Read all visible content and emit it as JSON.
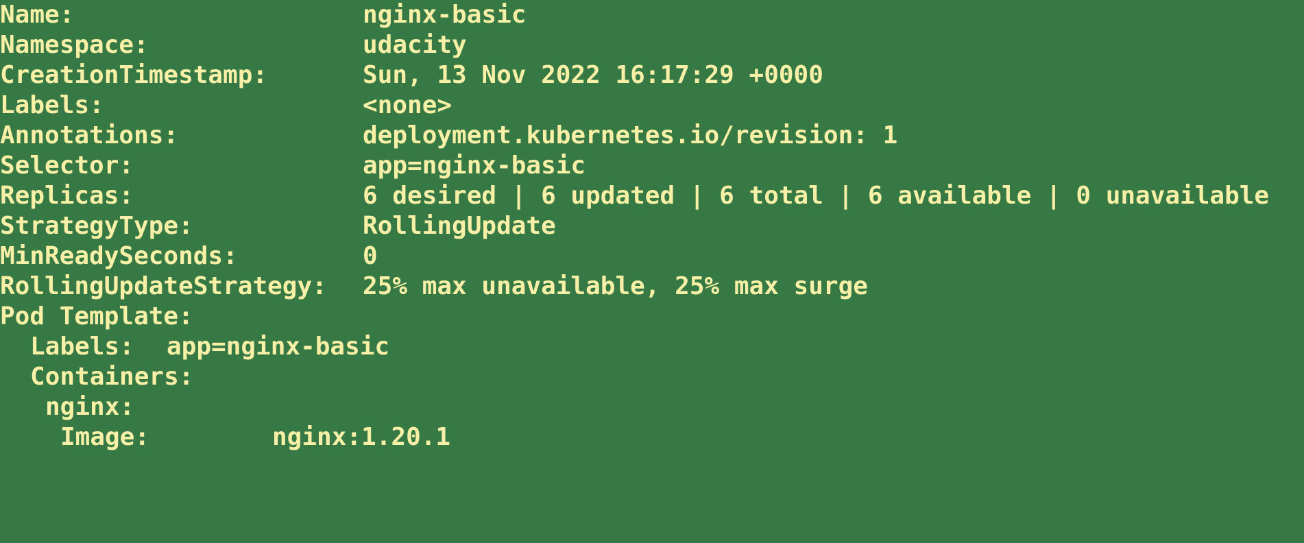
{
  "theme": {
    "background": "#377944",
    "foreground": "#f7f0a6"
  },
  "deployment": {
    "name": {
      "key": "Name:",
      "value": "nginx-basic"
    },
    "namespace": {
      "key": "Namespace:",
      "value": "udacity"
    },
    "creation_timestamp": {
      "key": "CreationTimestamp:",
      "value": "Sun, 13 Nov 2022 16:17:29 +0000"
    },
    "labels": {
      "key": "Labels:",
      "value": "<none>"
    },
    "annotations": {
      "key": "Annotations:",
      "value": "deployment.kubernetes.io/revision: 1"
    },
    "selector": {
      "key": "Selector:",
      "value": "app=nginx-basic"
    },
    "replicas": {
      "key": "Replicas:",
      "value": "6 desired | 6 updated | 6 total | 6 available | 0 unavailable"
    },
    "strategy_type": {
      "key": "StrategyType:",
      "value": "RollingUpdate"
    },
    "min_ready_seconds": {
      "key": "MinReadySeconds:",
      "value": "0"
    },
    "rolling_update_strategy": {
      "key": "RollingUpdateStrategy:",
      "value": "25% max unavailable, 25% max surge"
    }
  },
  "pod_template": {
    "header": "Pod Template:",
    "labels": {
      "key": "Labels:",
      "value": "app=nginx-basic"
    },
    "containers": {
      "header": "Containers:",
      "nginx": {
        "header": "nginx:",
        "image": {
          "key": "Image:",
          "value": "nginx:1.20.1"
        }
      }
    }
  }
}
